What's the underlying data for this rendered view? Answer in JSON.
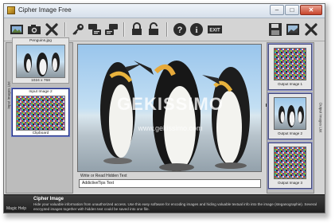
{
  "window": {
    "title": "Cipher Image Free",
    "minimize": "–",
    "maximize": "□",
    "close": "✕"
  },
  "toolbar": {
    "buttons": [
      {
        "name": "open-image",
        "icon": "folder-image-icon"
      },
      {
        "name": "camera",
        "icon": "camera-icon"
      },
      {
        "name": "remove",
        "icon": "x-icon"
      },
      {
        "name": "encode-key",
        "icon": "key-icon"
      },
      {
        "name": "encode",
        "icon": "encode-chat-icon"
      },
      {
        "name": "decode",
        "icon": "decode-chat-icon"
      },
      {
        "name": "lock",
        "icon": "lock-icon"
      },
      {
        "name": "unlock",
        "icon": "unlock-icon"
      },
      {
        "name": "help",
        "icon": "question-icon"
      },
      {
        "name": "info",
        "icon": "info-icon"
      },
      {
        "name": "exit",
        "icon": "exit-icon",
        "label": "EXIT"
      },
      {
        "name": "save",
        "icon": "floppy-icon"
      },
      {
        "name": "save-as",
        "icon": "save-image-icon"
      },
      {
        "name": "close-output",
        "icon": "x-icon"
      }
    ]
  },
  "left_panel": {
    "label": "Input Images List",
    "items": [
      {
        "name": "Penguins.jpg",
        "size": "1024 x 768"
      },
      {
        "name": "Input Image 2",
        "size": "Clipboard"
      }
    ]
  },
  "main": {
    "watermark": "GEKISSIMO",
    "watermark_url": "www.gekissimo.com",
    "add_label": "Add",
    "hidden_text_label": "Write or Read Hidden Text",
    "hidden_text_value": "AddictiveTips Text"
  },
  "right_panel": {
    "label": "Output Images List",
    "items": [
      "Output Image 1",
      "Output Image 2",
      "Output Image 3"
    ]
  },
  "help": {
    "label": "Magic Help",
    "title": "Cipher Image",
    "text": "Hide your valuable information from unauthorized access. Use this easy software for encoding images and hiding valuable textual info into the image (steganographie). Several encrypted images together with hidden text could be saved into one file."
  },
  "colors": {
    "accent": "#1b2a80",
    "help_bg": "#2b2b2b",
    "chrome": "#d4d4d4"
  }
}
